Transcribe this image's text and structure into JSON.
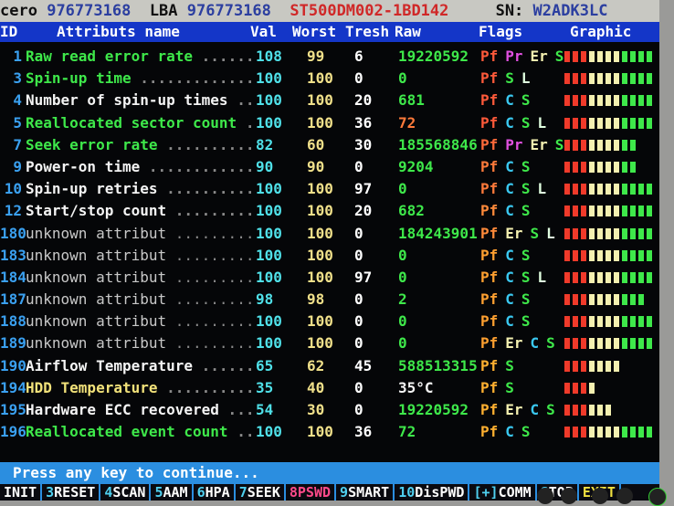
{
  "topbar": {
    "zero_label": "cero",
    "zero_value": "976773168",
    "lba_label": "LBA",
    "lba_value": "976773168",
    "model": "ST500DM002-1BD142",
    "sn_label": "SN:",
    "sn_value": "W2ADK3LC"
  },
  "header": {
    "id": "ID",
    "name": "Attributs name",
    "val": "Val",
    "worst": "Worst",
    "tresh": "Tresh",
    "raw": "Raw",
    "flags": "Flags",
    "graphic": "Graphic"
  },
  "colors": {
    "header_bg": "#1436c8",
    "status_bar_bg": "#2b8ee0",
    "bar_red": "#f03a2a",
    "bar_yellow": "#f4f0b0",
    "bar_green": "#3ee84a"
  },
  "rows": [
    {
      "id": "1",
      "name": "Raw read error rate",
      "name_color": "green",
      "val": "108",
      "worst": "99",
      "tresh": "6",
      "raw": "19220592",
      "raw_color": "green",
      "flags": [
        {
          "t": "Pf",
          "c": "#ff5a3a"
        },
        {
          "t": "Pr",
          "c": "#e050e0"
        },
        {
          "t": "Er",
          "c": "#f4f0b0"
        },
        {
          "t": "S",
          "c": "#3ee84a"
        }
      ],
      "bars": 11
    },
    {
      "id": "3",
      "name": "Spin-up time",
      "name_color": "green",
      "val": "100",
      "worst": "100",
      "tresh": "0",
      "raw": "0",
      "raw_color": "green",
      "flags": [
        {
          "t": "Pf",
          "c": "#ff5a3a"
        },
        {
          "t": "S",
          "c": "#3ee84a"
        },
        {
          "t": "L",
          "c": "#e0ffe0"
        }
      ],
      "bars": 11
    },
    {
      "id": "4",
      "name": "Number of spin-up times",
      "name_color": "white",
      "val": "100",
      "worst": "100",
      "tresh": "20",
      "raw": "681",
      "raw_color": "green",
      "flags": [
        {
          "t": "Pf",
          "c": "#ff5a3a"
        },
        {
          "t": "C",
          "c": "#3ac8f0"
        },
        {
          "t": "S",
          "c": "#3ee84a"
        }
      ],
      "bars": 11
    },
    {
      "id": "5",
      "name": "Reallocated sector count",
      "name_color": "green",
      "val": "100",
      "worst": "100",
      "tresh": "36",
      "raw": "72",
      "raw_color": "orange",
      "flags": [
        {
          "t": "Pf",
          "c": "#ff5a3a"
        },
        {
          "t": "C",
          "c": "#3ac8f0"
        },
        {
          "t": "S",
          "c": "#3ee84a"
        },
        {
          "t": "L",
          "c": "#e0ffe0"
        }
      ],
      "bars": 11
    },
    {
      "id": "7",
      "name": "Seek error rate",
      "name_color": "green",
      "val": "82",
      "worst": "60",
      "tresh": "30",
      "raw": "185568846",
      "raw_color": "green",
      "flags": [
        {
          "t": "Pf",
          "c": "#ff6a3a"
        },
        {
          "t": "Pr",
          "c": "#e050e0"
        },
        {
          "t": "Er",
          "c": "#f4f0b0"
        },
        {
          "t": "S",
          "c": "#3ee84a"
        }
      ],
      "bars": 9
    },
    {
      "id": "9",
      "name": "Power-on time",
      "name_color": "white",
      "val": "90",
      "worst": "90",
      "tresh": "0",
      "raw": "9204",
      "raw_color": "green",
      "flags": [
        {
          "t": "Pf",
          "c": "#ff7a3a"
        },
        {
          "t": "C",
          "c": "#3ac8f0"
        },
        {
          "t": "S",
          "c": "#3ee84a"
        }
      ],
      "bars": 9
    },
    {
      "id": "10",
      "name": "Spin-up retries",
      "name_color": "white",
      "val": "100",
      "worst": "100",
      "tresh": "97",
      "raw": "0",
      "raw_color": "green",
      "flags": [
        {
          "t": "Pf",
          "c": "#ff7a3a"
        },
        {
          "t": "C",
          "c": "#3ac8f0"
        },
        {
          "t": "S",
          "c": "#3ee84a"
        },
        {
          "t": "L",
          "c": "#e0ffe0"
        }
      ],
      "bars": 11
    },
    {
      "id": "12",
      "name": "Start/stop count",
      "name_color": "white",
      "val": "100",
      "worst": "100",
      "tresh": "20",
      "raw": "682",
      "raw_color": "green",
      "flags": [
        {
          "t": "Pf",
          "c": "#ff8a3a"
        },
        {
          "t": "C",
          "c": "#3ac8f0"
        },
        {
          "t": "S",
          "c": "#3ee84a"
        }
      ],
      "bars": 11
    },
    {
      "id": "180",
      "name": "unknown attribut",
      "name_color": "gray",
      "val": "100",
      "worst": "100",
      "tresh": "0",
      "raw": "184243901",
      "raw_color": "green",
      "flags": [
        {
          "t": "Pf",
          "c": "#ff8a3a"
        },
        {
          "t": "Er",
          "c": "#f4f0b0"
        },
        {
          "t": "S",
          "c": "#3ee84a"
        },
        {
          "t": "L",
          "c": "#e0ffe0"
        }
      ],
      "bars": 11
    },
    {
      "id": "183",
      "name": "unknown attribut",
      "name_color": "gray",
      "val": "100",
      "worst": "100",
      "tresh": "0",
      "raw": "0",
      "raw_color": "green",
      "flags": [
        {
          "t": "Pf",
          "c": "#ffa030"
        },
        {
          "t": "C",
          "c": "#3ac8f0"
        },
        {
          "t": "S",
          "c": "#3ee84a"
        }
      ],
      "bars": 11
    },
    {
      "id": "184",
      "name": "unknown attribut",
      "name_color": "gray",
      "val": "100",
      "worst": "100",
      "tresh": "97",
      "raw": "0",
      "raw_color": "green",
      "flags": [
        {
          "t": "Pf",
          "c": "#ffa030"
        },
        {
          "t": "C",
          "c": "#3ac8f0"
        },
        {
          "t": "S",
          "c": "#3ee84a"
        },
        {
          "t": "L",
          "c": "#e0ffe0"
        }
      ],
      "bars": 11
    },
    {
      "id": "187",
      "name": "unknown attribut",
      "name_color": "gray",
      "val": "98",
      "worst": "98",
      "tresh": "0",
      "raw": "2",
      "raw_color": "green",
      "flags": [
        {
          "t": "Pf",
          "c": "#ffa030"
        },
        {
          "t": "C",
          "c": "#3ac8f0"
        },
        {
          "t": "S",
          "c": "#3ee84a"
        }
      ],
      "bars": 10
    },
    {
      "id": "188",
      "name": "unknown attribut",
      "name_color": "gray",
      "val": "100",
      "worst": "100",
      "tresh": "0",
      "raw": "0",
      "raw_color": "green",
      "flags": [
        {
          "t": "Pf",
          "c": "#ffa030"
        },
        {
          "t": "C",
          "c": "#3ac8f0"
        },
        {
          "t": "S",
          "c": "#3ee84a"
        }
      ],
      "bars": 11
    },
    {
      "id": "189",
      "name": "unknown attribut",
      "name_color": "gray",
      "val": "100",
      "worst": "100",
      "tresh": "0",
      "raw": "0",
      "raw_color": "green",
      "flags": [
        {
          "t": "Pf",
          "c": "#ffa030"
        },
        {
          "t": "Er",
          "c": "#f4f0b0"
        },
        {
          "t": "C",
          "c": "#3ac8f0"
        },
        {
          "t": "S",
          "c": "#3ee84a"
        }
      ],
      "bars": 11
    },
    {
      "id": "190",
      "name": "Airflow Temperature",
      "name_color": "white",
      "val": "65",
      "worst": "62",
      "tresh": "45",
      "raw": "588513315",
      "raw_color": "green",
      "flags": [
        {
          "t": "Pf",
          "c": "#ffb030"
        },
        {
          "t": "S",
          "c": "#3ee84a"
        }
      ],
      "bars": 7
    },
    {
      "id": "194",
      "name": "HDD Temperature",
      "name_color": "yellow",
      "val": "35",
      "worst": "40",
      "tresh": "0",
      "raw": "35°C",
      "raw_color": "white",
      "flags": [
        {
          "t": "Pf",
          "c": "#ffb030"
        },
        {
          "t": "S",
          "c": "#3ee84a"
        }
      ],
      "bars": 4
    },
    {
      "id": "195",
      "name": "Hardware ECC recovered",
      "name_color": "white",
      "val": "54",
      "worst": "30",
      "tresh": "0",
      "raw": "19220592",
      "raw_color": "green",
      "flags": [
        {
          "t": "Pf",
          "c": "#ffb030"
        },
        {
          "t": "Er",
          "c": "#f4f0b0"
        },
        {
          "t": "C",
          "c": "#3ac8f0"
        },
        {
          "t": "S",
          "c": "#3ee84a"
        }
      ],
      "bars": 6
    },
    {
      "id": "196",
      "name": "Reallocated event count",
      "name_color": "green",
      "val": "100",
      "worst": "100",
      "tresh": "36",
      "raw": "72",
      "raw_color": "green",
      "flags": [
        {
          "t": "Pf",
          "c": "#ffb030"
        },
        {
          "t": "C",
          "c": "#3ac8f0"
        },
        {
          "t": "S",
          "c": "#3ee84a"
        }
      ],
      "bars": 11
    }
  ],
  "status": {
    "message": "Press any key to continue..."
  },
  "function_keys": [
    {
      "num": "",
      "label": "INIT"
    },
    {
      "num": "3",
      "label": "RESET"
    },
    {
      "num": "4",
      "label": "SCAN"
    },
    {
      "num": "5",
      "label": "AAM"
    },
    {
      "num": "6",
      "label": "HPA"
    },
    {
      "num": "7",
      "label": "SEEK"
    },
    {
      "num": "8",
      "label": "PSWD"
    },
    {
      "num": "9",
      "label": "SMART"
    },
    {
      "num": "10",
      "label": "DisPWD"
    },
    {
      "num": "[+]",
      "label": "COMM"
    },
    {
      "num": "S",
      "label": "TOP"
    },
    {
      "num": "E",
      "label": "XIT"
    }
  ]
}
